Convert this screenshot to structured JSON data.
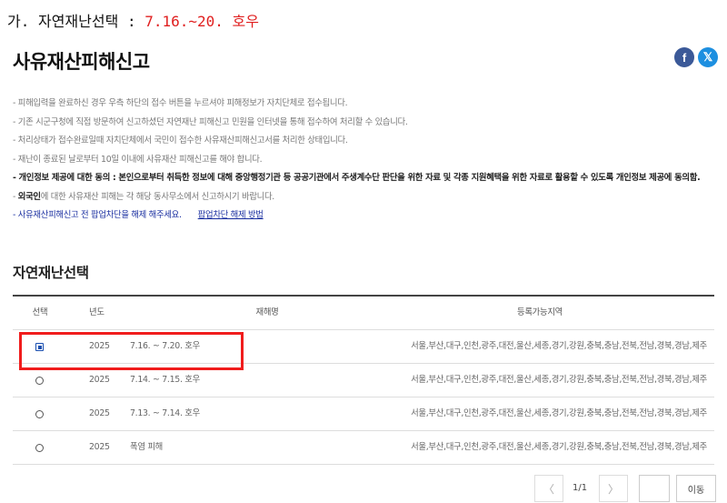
{
  "top_heading": {
    "prefix": "가. 자연재난선택 : ",
    "highlight": "7.16.~20. 호우"
  },
  "page_title": "사유재산피해신고",
  "share": {
    "facebook_glyph": "f",
    "twitter_glyph": "𝕏",
    "facebook_color": "#3b5998",
    "twitter_color": "#1d8fe0"
  },
  "notices": [
    "- 피해입력을 완료하신 경우 우측 하단의 접수 버튼을 누르셔야 피해정보가 자치단체로 접수됩니다.",
    "- 기존 시군구청에 직접 방문하여 신고하셨던 자연재난 피해신고 민원을 인터넷을 통해 접수하여 처리할 수 있습니다.",
    "- 처리상태가 접수완료일때 자치단체에서 국민이 접수한 사유재산피해신고서를 처리한 상태입니다.",
    "- 재난이 종료된 날로부터 10일 이내에 사유재산 피해신고를 해야 합니다.",
    "- 개인정보 제공에 대한 동의 : 본인으로부터 취득한 정보에 대해 중앙행정기관 등 공공기관에서 주생계수단 판단을 위한 자료 및 각종 지원혜택을 위한 자료로 활용할 수 있도록 개인정보 제공에 동의함."
  ],
  "notice_foreign": {
    "bold": "외국인",
    "rest": "에 대한 사유재산 피해는 각 해당 동사무소에서 신고하시기 바랍니다.",
    "prefix": "- "
  },
  "notice_popup": {
    "text": "- 사유재산피해신고 전 팝업차단을 해제 해주세요.",
    "link": "팝업차단 해제 방법"
  },
  "section_title": "자연재난선택",
  "table": {
    "headers": {
      "select": "선택",
      "year": "년도",
      "name": "재해명",
      "region": "등록가능지역"
    },
    "rows": [
      {
        "year": "2025",
        "name": "7.16. ~ 7.20. 호우",
        "region": "서울,부산,대구,인천,광주,대전,울산,세종,경기,강원,충북,충남,전북,전남,경북,경남,제주",
        "selected": true
      },
      {
        "year": "2025",
        "name": "7.14. ~ 7.15. 호우",
        "region": "서울,부산,대구,인천,광주,대전,울산,세종,경기,강원,충북,충남,전북,전남,경북,경남,제주",
        "selected": false
      },
      {
        "year": "2025",
        "name": "7.13. ~ 7.14. 호우",
        "region": "서울,부산,대구,인천,광주,대전,울산,세종,경기,강원,충북,충남,전북,전남,경북,경남,제주",
        "selected": false
      },
      {
        "year": "2025",
        "name": "폭염 피해",
        "region": "서울,부산,대구,인천,광주,대전,울산,세종,경기,강원,충북,충남,전북,전남,경북,경남,제주",
        "selected": false
      }
    ]
  },
  "pager": {
    "prev_icon": "chevron-left-icon",
    "next_icon": "chevron-right-icon",
    "prev_glyph": "〈",
    "next_glyph": "〉",
    "page_text": "1/1",
    "go_label": "이동"
  },
  "colors": {
    "highlight_red": "#e02020",
    "link_blue": "#1a2fa0",
    "radio_blue": "#1a4fb0"
  }
}
